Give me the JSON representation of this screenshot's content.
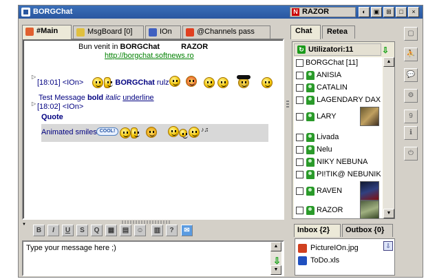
{
  "window": {
    "title": "BORGChat",
    "current_user": "RAZOR",
    "user_badge": "N"
  },
  "titlebar_buttons": [
    "◐",
    "▣",
    "⊞",
    "□",
    "×"
  ],
  "tabs": [
    {
      "label": "#Main",
      "color": "#e06030"
    },
    {
      "label": "MsgBoard [0]",
      "color": "#e0c040"
    },
    {
      "label": "IOn",
      "color": "#4060c0"
    },
    {
      "label": "@Channels pass",
      "color": "#e04020"
    }
  ],
  "chat": {
    "welcome_prefix": "Bun venit in",
    "welcome_app": "BORGChat",
    "welcome_user": "RAZOR",
    "welcome_link": "http://borgchat.softnews.ro",
    "messages": [
      {
        "time": "[18:01]",
        "nick": "<IOn>",
        "sender": "BORGChat",
        "text": "rulz"
      },
      {
        "test_plain": "Test Message",
        "test_bold": "bold",
        "test_italic": "italic",
        "test_underline": "underline"
      },
      {
        "time": "[18:02]",
        "nick": "<IOn>",
        "quote": "Quote"
      },
      {
        "anim_label": "Animated smiles",
        "cool_badge": "COOL!"
      }
    ]
  },
  "format_toolbar": [
    "B",
    "I",
    "U",
    "S",
    "Q",
    "▦",
    "▤",
    "☺",
    "▥",
    "?",
    "✉"
  ],
  "input": {
    "placeholder": "Type your message here ;)",
    "value": "Type your message here ;)"
  },
  "right_tabs": [
    {
      "label": "Chat"
    },
    {
      "label": "Retea"
    }
  ],
  "users": {
    "header": "Utilizatori:11",
    "group": "BORGChat [11]",
    "list": [
      "ANISIA",
      "CATALIN",
      "LAGENDARY DAX",
      "LARY",
      "Livada",
      "Nelu",
      "NIKY NEBUNA",
      "PI!TIK@ NEBUNIK",
      "RAVEN",
      "RAZOR"
    ]
  },
  "inbox": {
    "inbox_label": "Inbox {2}",
    "outbox_label": "Outbox {0}",
    "files": [
      {
        "name": "PictureIOn.jpg",
        "color": "#d04020"
      },
      {
        "name": "ToDo.xls",
        "color": "#2050c0"
      }
    ]
  },
  "sidebar_buttons": [
    "▢",
    "⛹",
    "💬",
    "⚙",
    "9",
    "ℹ",
    "⏻"
  ]
}
